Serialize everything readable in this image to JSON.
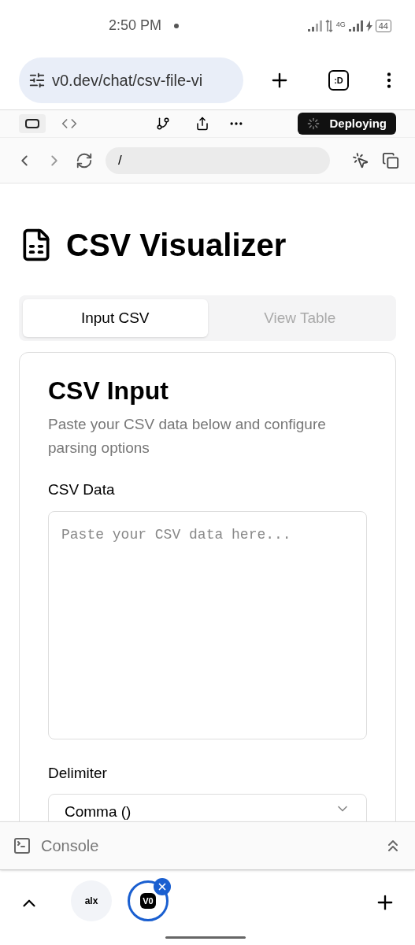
{
  "status_bar": {
    "time": "2:50 PM",
    "network": "4G",
    "battery": "44"
  },
  "browser": {
    "url": "v0.dev/chat/csv-file-vi",
    "tab_badge": ":D"
  },
  "toolbar": {
    "deploy_label": "Deploying"
  },
  "preview_nav": {
    "path": "/"
  },
  "page": {
    "title": "CSV Visualizer",
    "tabs": [
      {
        "label": "Input CSV",
        "selected": true
      },
      {
        "label": "View Table",
        "selected": false
      }
    ],
    "card": {
      "title": "CSV Input",
      "description": "Paste your CSV data below and configure parsing options",
      "data_label": "CSV Data",
      "data_placeholder": "Paste your CSV data here...",
      "delimiter_label": "Delimiter",
      "delimiter_value": "Comma ()"
    }
  },
  "console": {
    "label": "Console"
  },
  "tab_strip": {
    "tabs": [
      {
        "label": "alx",
        "selected": false
      },
      {
        "label": "V0",
        "selected": true
      }
    ]
  }
}
